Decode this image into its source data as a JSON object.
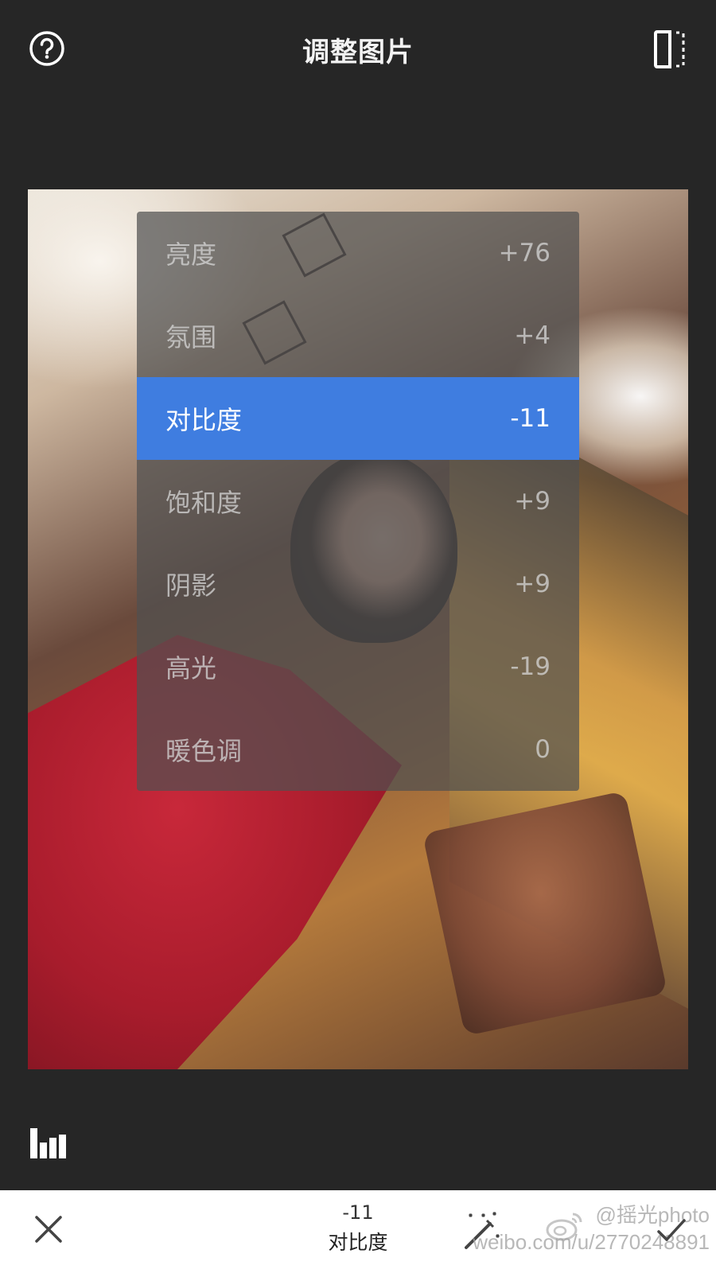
{
  "header": {
    "title": "调整图片",
    "help_icon": "help-circle-icon",
    "compare_icon": "compare-split-icon"
  },
  "adjust_menu": {
    "items": [
      {
        "label": "亮度",
        "value": "+76",
        "selected": false
      },
      {
        "label": "氛围",
        "value": "+4",
        "selected": false
      },
      {
        "label": "对比度",
        "value": "-11",
        "selected": true
      },
      {
        "label": "饱和度",
        "value": "+9",
        "selected": false
      },
      {
        "label": "阴影",
        "value": "+9",
        "selected": false
      },
      {
        "label": "高光",
        "value": "-19",
        "selected": false
      },
      {
        "label": "暖色调",
        "value": "0",
        "selected": false
      }
    ],
    "accent_color": "#3f7de0"
  },
  "toolbar": {
    "current_value": "-11",
    "current_param": "对比度",
    "cancel_icon": "close-icon",
    "auto_icon": "magic-wand-icon",
    "confirm_icon": "check-icon",
    "histogram_icon": "histogram-icon"
  },
  "watermark": {
    "handle": "@摇光photo",
    "url": "weibo.com/u/2770248891"
  }
}
